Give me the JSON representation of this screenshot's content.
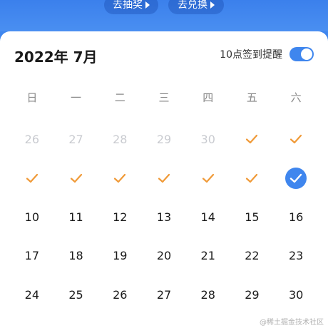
{
  "header": {
    "lottery_button": "去抽奖",
    "exchange_button": "去兑换"
  },
  "calendar": {
    "title": "2022年 7月",
    "reminder_label": "10点签到提醒",
    "reminder_on": true,
    "accent_color": "#3f86ee",
    "check_color": "#f09a38",
    "weekdays": [
      "日",
      "一",
      "二",
      "三",
      "四",
      "五",
      "六"
    ],
    "rows": [
      [
        {
          "text": "26",
          "state": "muted"
        },
        {
          "text": "27",
          "state": "muted"
        },
        {
          "text": "28",
          "state": "muted"
        },
        {
          "text": "29",
          "state": "muted"
        },
        {
          "text": "30",
          "state": "muted"
        },
        {
          "text": "",
          "state": "checked"
        },
        {
          "text": "",
          "state": "checked"
        }
      ],
      [
        {
          "text": "",
          "state": "checked"
        },
        {
          "text": "",
          "state": "checked"
        },
        {
          "text": "",
          "state": "checked"
        },
        {
          "text": "",
          "state": "checked"
        },
        {
          "text": "",
          "state": "checked"
        },
        {
          "text": "",
          "state": "checked"
        },
        {
          "text": "",
          "state": "today"
        }
      ],
      [
        {
          "text": "10",
          "state": "normal"
        },
        {
          "text": "11",
          "state": "normal"
        },
        {
          "text": "12",
          "state": "normal"
        },
        {
          "text": "13",
          "state": "normal"
        },
        {
          "text": "14",
          "state": "normal"
        },
        {
          "text": "15",
          "state": "normal"
        },
        {
          "text": "16",
          "state": "normal"
        }
      ],
      [
        {
          "text": "17",
          "state": "normal"
        },
        {
          "text": "18",
          "state": "normal"
        },
        {
          "text": "19",
          "state": "normal"
        },
        {
          "text": "20",
          "state": "normal"
        },
        {
          "text": "21",
          "state": "normal"
        },
        {
          "text": "22",
          "state": "normal"
        },
        {
          "text": "23",
          "state": "normal"
        }
      ],
      [
        {
          "text": "24",
          "state": "normal"
        },
        {
          "text": "25",
          "state": "normal"
        },
        {
          "text": "26",
          "state": "normal"
        },
        {
          "text": "27",
          "state": "normal"
        },
        {
          "text": "28",
          "state": "normal"
        },
        {
          "text": "29",
          "state": "normal"
        },
        {
          "text": "30",
          "state": "normal"
        }
      ]
    ]
  },
  "watermark": "@稀土掘金技术社区"
}
